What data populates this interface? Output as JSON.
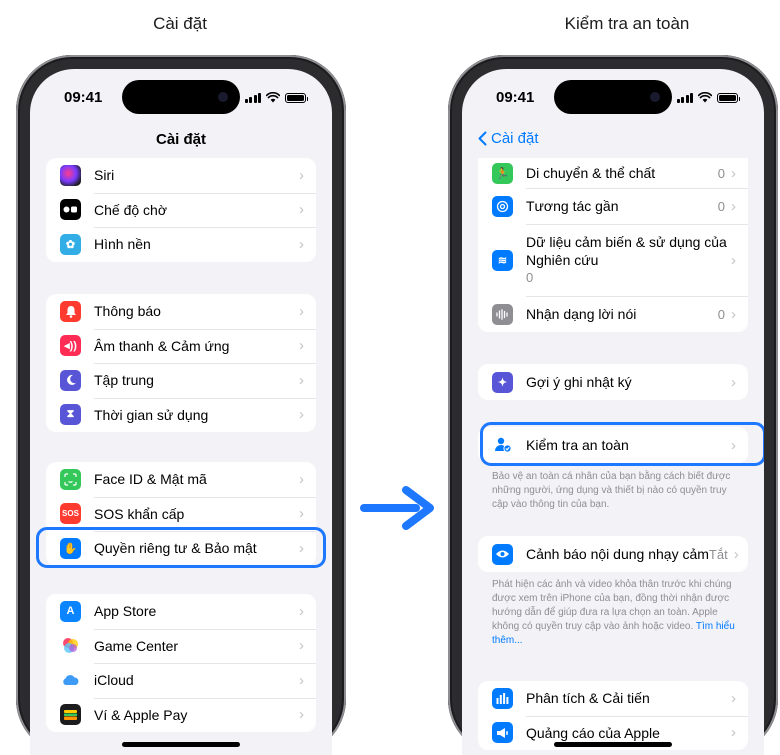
{
  "left_caption": "Cài đặt",
  "right_caption": "Kiểm tra an toàn",
  "status_time": "09:41",
  "colors": {
    "accent": "#007aff",
    "highlight": "#1e78ff",
    "background": "#f2f2f7"
  },
  "left": {
    "nav_title": "Cài đặt",
    "group1": [
      {
        "label": "Siri",
        "icon": "siri-icon"
      },
      {
        "label": "Chế độ chờ",
        "icon": "standby-icon"
      },
      {
        "label": "Hình nền",
        "icon": "wallpaper-icon"
      }
    ],
    "group2": [
      {
        "label": "Thông báo",
        "icon": "bell-icon"
      },
      {
        "label": "Âm thanh & Cảm ứng",
        "icon": "speaker-icon"
      },
      {
        "label": "Tập trung",
        "icon": "moon-icon"
      },
      {
        "label": "Thời gian sử dụng",
        "icon": "hourglass-icon"
      }
    ],
    "group3": [
      {
        "label": "Face ID & Mật mã",
        "icon": "faceid-icon"
      },
      {
        "label": "SOS khẩn cấp",
        "icon": "sos-icon"
      },
      {
        "label": "Quyền riêng tư & Bảo mật",
        "icon": "hand-icon"
      }
    ],
    "group4": [
      {
        "label": "App Store",
        "icon": "appstore-icon"
      },
      {
        "label": "Game Center",
        "icon": "gamecenter-icon"
      },
      {
        "label": "iCloud",
        "icon": "icloud-icon"
      },
      {
        "label": "Ví & Apple Pay",
        "icon": "wallet-icon"
      }
    ],
    "sos_text": "SOS"
  },
  "right": {
    "back_label": "Cài đặt",
    "group1": {
      "motion": {
        "label": "Di chuyển & thể chất",
        "value": "0"
      },
      "nearby": {
        "label": "Tương tác gần",
        "value": "0"
      },
      "sensor": {
        "line1": "Dữ liệu cảm biến & sử dụng của",
        "line2": "Nghiên cứu",
        "value": "0"
      },
      "speech": {
        "label": "Nhận dạng lời nói",
        "value": "0"
      }
    },
    "journal": {
      "label": "Gợi ý ghi nhật ký"
    },
    "safety": {
      "label": "Kiểm tra an toàn",
      "footer": "Bảo vệ an toàn cá nhân của bạn bằng cách biết được những người, ứng dụng và thiết bị nào có quyền truy cập vào thông tin của bạn."
    },
    "sensitive": {
      "label": "Cảnh báo nội dung nhạy cảm",
      "value": "Tắt",
      "footer": "Phát hiện các ảnh và video khỏa thân trước khi chúng được xem trên iPhone của bạn, đồng thời nhận được hướng dẫn để giúp đưa ra lựa chọn an toàn. Apple không có quyền truy cập vào ảnh hoặc video.",
      "link": "Tìm hiểu thêm..."
    },
    "group4": [
      {
        "label": "Phân tích & Cải tiến",
        "icon": "analytics-icon"
      },
      {
        "label": "Quảng cáo của Apple",
        "icon": "ads-icon"
      }
    ]
  }
}
